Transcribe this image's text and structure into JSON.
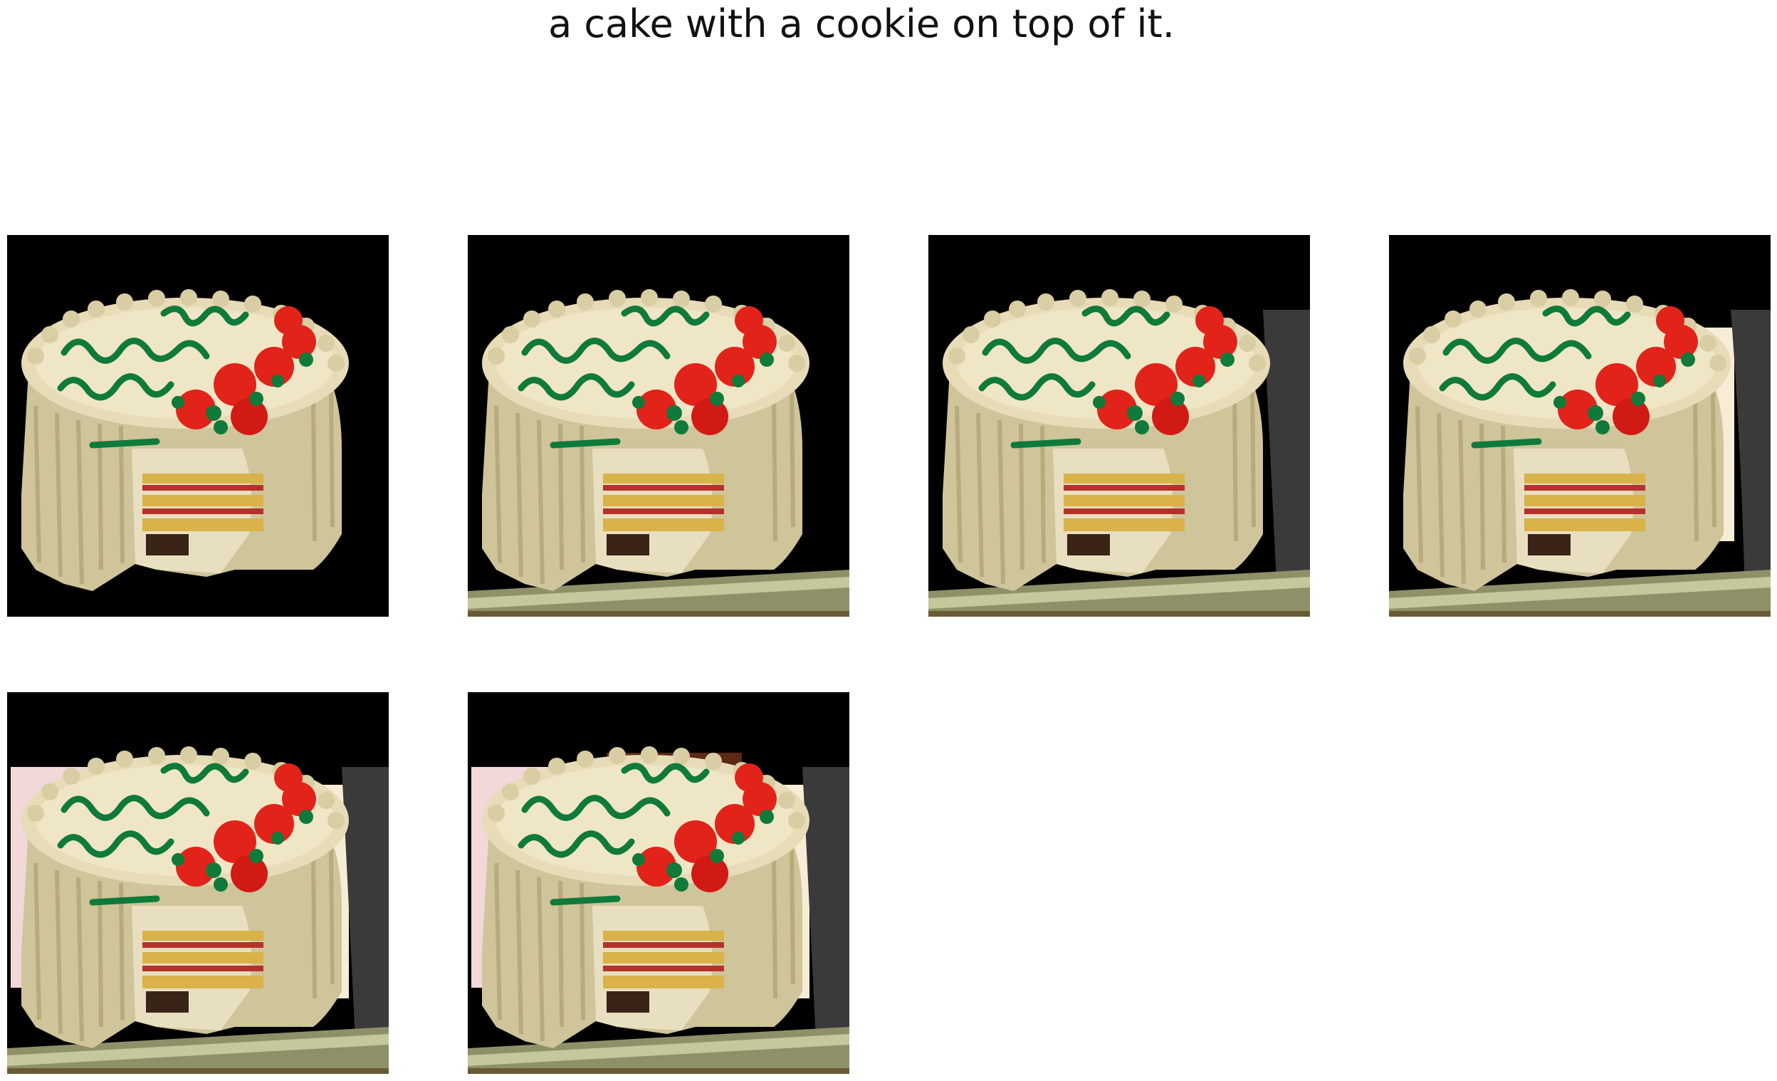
{
  "caption": "a cake with a cookie on top of it.",
  "frames": [
    {
      "id": 1,
      "content": "cake-masked"
    },
    {
      "id": 2,
      "content": "cake-with-stand"
    },
    {
      "id": 3,
      "content": "cake-with-stand-and-post"
    },
    {
      "id": 4,
      "content": "cake-with-stand-post-and-light"
    },
    {
      "id": 5,
      "content": "cake-with-stand-post-and-pink-wall"
    },
    {
      "id": 6,
      "content": "cake-with-stand-post-pink-wall-and-shelf"
    }
  ],
  "colors": {
    "background": "#000000",
    "frosting": "#ddd3ad",
    "frosting_shadow": "#b8aa7a",
    "lettering": "#0f7a3a",
    "roses": "#e2231a",
    "sponge": "#d9b24a",
    "jam": "#b5322a",
    "stand": "#9b9a6a",
    "post": "#3a3a3a",
    "pink_wall": "#f2d8d8",
    "shelf": "#5a2a14"
  }
}
